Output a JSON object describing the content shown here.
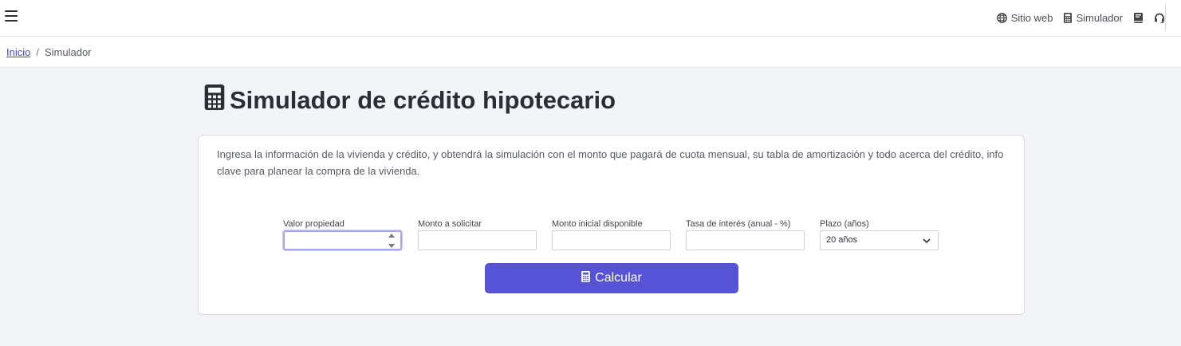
{
  "topnav": {
    "items": [
      {
        "label": "Sitio web",
        "icon": "globe-icon"
      },
      {
        "label": "Simulador",
        "icon": "calculator-icon"
      },
      {
        "label": "",
        "icon": "book-icon"
      },
      {
        "label": "",
        "icon": "headset-icon"
      }
    ]
  },
  "breadcrumb": {
    "home": "Inicio",
    "separator": "/",
    "current": "Simulador"
  },
  "page": {
    "title": "Simulador de crédito hipotecario",
    "description": "Ingresa la información de la vivienda y crédito, y obtendrá la simulación con el monto que pagará de cuota mensual, su tabla de amortización y todo acerca del crédito, info clave para planear la compra de la vivienda."
  },
  "form": {
    "fields": [
      {
        "label": "Valor propiedad",
        "value": "",
        "type": "number"
      },
      {
        "label": "Monto a solicitar",
        "value": ""
      },
      {
        "label": "Monto inicial disponible",
        "value": ""
      },
      {
        "label": "Tasa de interés (anual - %)",
        "value": ""
      },
      {
        "label": "Plazo (años)",
        "value": "20 años",
        "type": "select"
      }
    ],
    "submit_label": "Calcular"
  },
  "colors": {
    "accent": "#5753d6",
    "link": "#4a44c9",
    "background": "#f3f4f7"
  }
}
